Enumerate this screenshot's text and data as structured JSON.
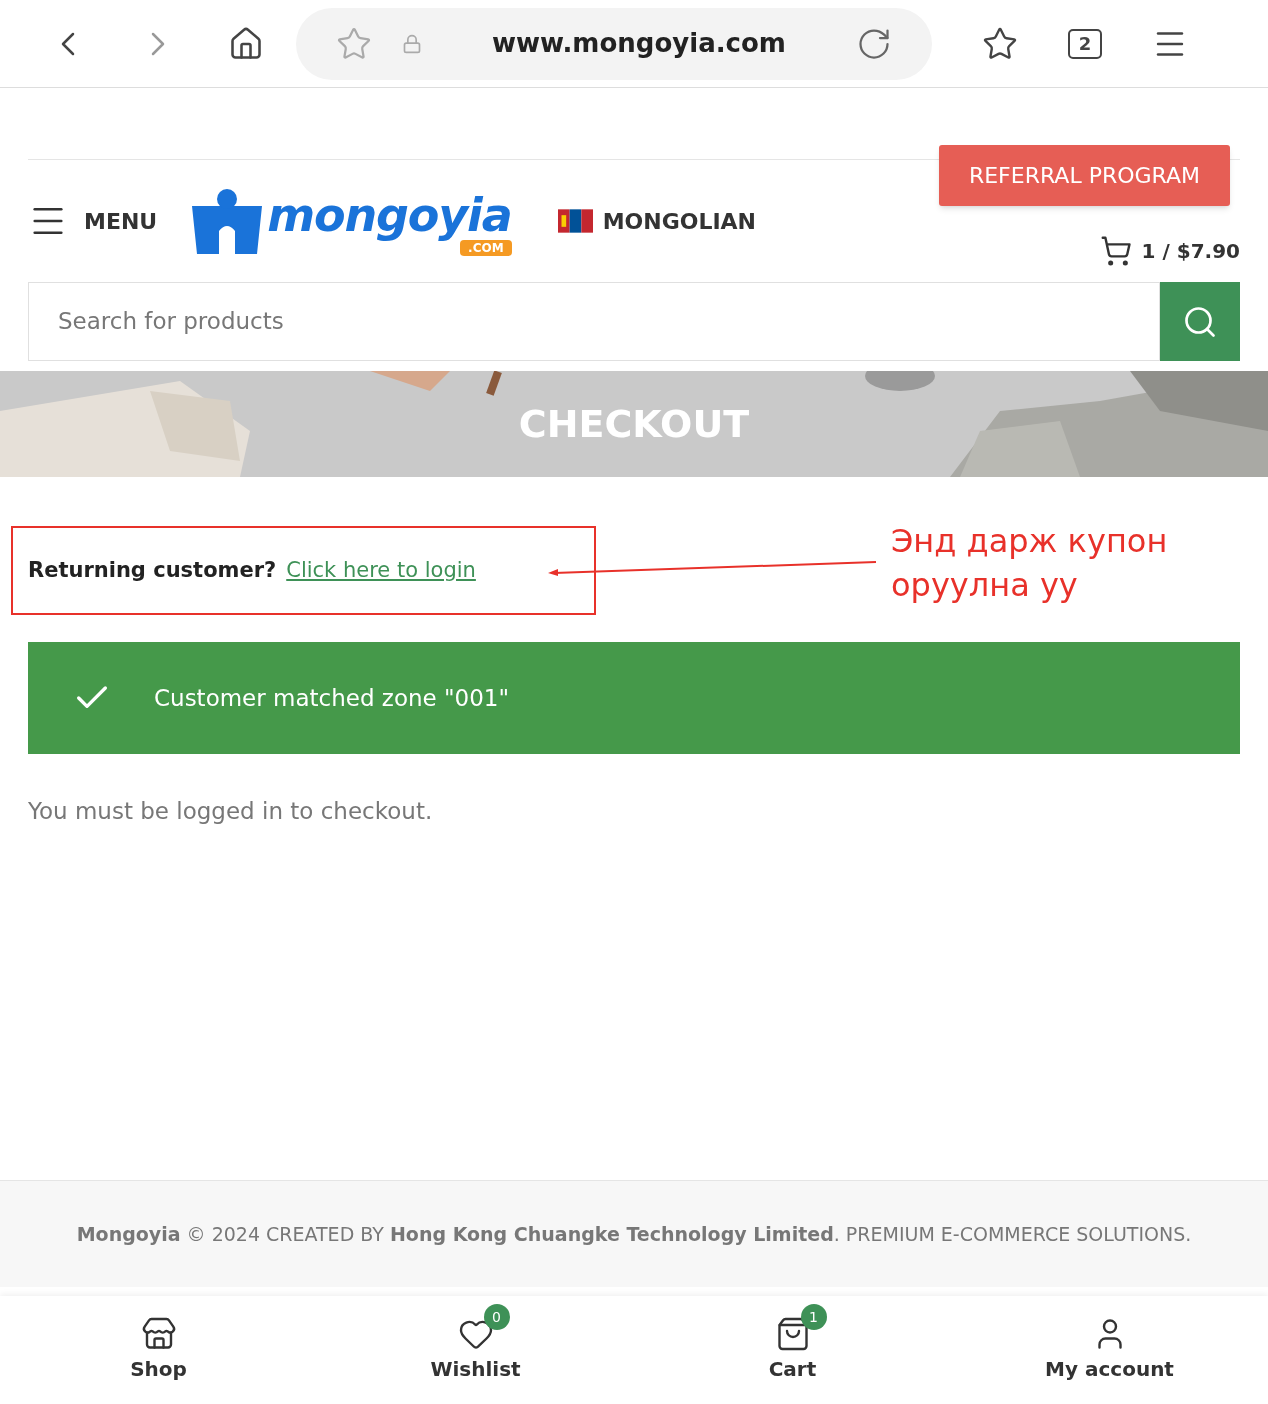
{
  "browser": {
    "url": "www.mongoyia.com",
    "tab_count": "2"
  },
  "header": {
    "menu_label": "MENU",
    "logo": {
      "name": "mongoyia",
      "suffix": ".COM"
    },
    "language": "MONGOLIAN",
    "cart_total": "1 / $7.90",
    "referral_button": "REFERRAL PROGRAM"
  },
  "search": {
    "placeholder": "Search for products"
  },
  "banner": {
    "title": "CHECKOUT"
  },
  "login_notice": {
    "prompt": "Returning customer?",
    "link": "Click here to login"
  },
  "annotation": {
    "text": "Энд дарж купон оруулна уу"
  },
  "success_message": "Customer matched zone \"001\"",
  "login_required": "You must be logged in to checkout.",
  "footer": {
    "text": "**Mongoyia** © 2024 CREATED BY **Hong Kong Chuangke Technology Limited**. PREMIUM E-COMMERCE SOLUTIONS."
  },
  "bottom_nav": [
    {
      "kind": "shop",
      "label": "Shop"
    },
    {
      "kind": "wishlist",
      "label": "Wishlist",
      "count": "0"
    },
    {
      "kind": "cart",
      "label": "Cart",
      "count": "1"
    },
    {
      "kind": "account",
      "label": "My account"
    }
  ]
}
